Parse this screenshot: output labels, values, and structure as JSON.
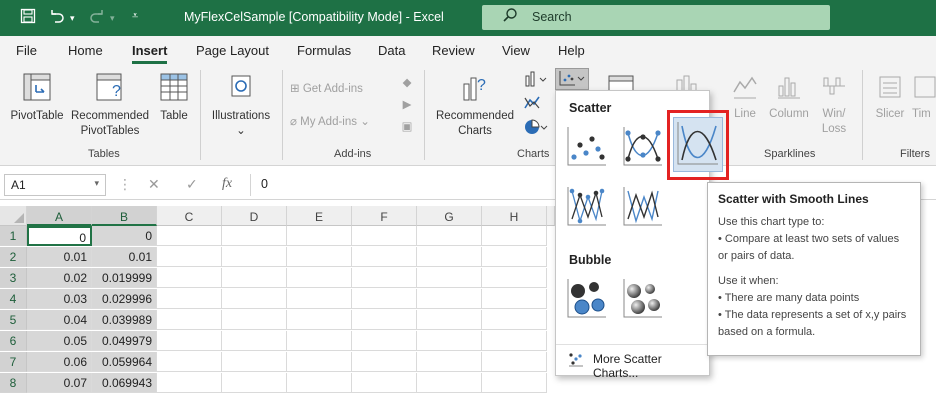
{
  "window": {
    "title": "MyFlexCelSample  [Compatibility Mode]  -  Excel",
    "search_placeholder": "Search"
  },
  "tabs": [
    "File",
    "Home",
    "Insert",
    "Page Layout",
    "Formulas",
    "Data",
    "Review",
    "View",
    "Help"
  ],
  "active_tab": "Insert",
  "ribbon": {
    "tables": {
      "group_label": "Tables",
      "pivottable": "PivotTable",
      "recommended_pivottables_1": "Recommended",
      "recommended_pivottables_2": "PivotTables",
      "table": "Table"
    },
    "illustrations": {
      "label": "Illustrations",
      "caret": "⌄"
    },
    "addins": {
      "group_label": "Add-ins",
      "get_addins": "Get Add-ins",
      "my_addins": "My Add-ins"
    },
    "charts": {
      "group_label": "Charts",
      "recommended_charts_1": "Recommended",
      "recommended_charts_2": "Charts"
    },
    "sparklines": {
      "group_label": "Sparklines",
      "line": "Line",
      "column": "Column",
      "winloss_1": "Win/",
      "winloss_2": "Loss"
    },
    "filters": {
      "group_label": "Filters",
      "slicer": "Slicer",
      "timeline": "Tim"
    }
  },
  "formula_bar": {
    "name_box": "A1",
    "fx_label": "fx",
    "value": "0"
  },
  "grid": {
    "columns": [
      "A",
      "B",
      "C",
      "D",
      "E",
      "F",
      "G",
      "H"
    ],
    "rows": [
      {
        "num": "1",
        "a": "0",
        "b": "0"
      },
      {
        "num": "2",
        "a": "0.01",
        "b": "0.01"
      },
      {
        "num": "3",
        "a": "0.02",
        "b": "0.019999"
      },
      {
        "num": "4",
        "a": "0.03",
        "b": "0.029996"
      },
      {
        "num": "5",
        "a": "0.04",
        "b": "0.039989"
      },
      {
        "num": "6",
        "a": "0.05",
        "b": "0.049979"
      },
      {
        "num": "7",
        "a": "0.06",
        "b": "0.059964"
      },
      {
        "num": "8",
        "a": "0.07",
        "b": "0.069943"
      }
    ]
  },
  "scatter_menu": {
    "scatter_header": "Scatter",
    "bubble_header": "Bubble",
    "more_link": "More Scatter Charts..."
  },
  "tooltip": {
    "title": "Scatter with Smooth Lines",
    "use_to": "Use this chart type to:",
    "bullet1": "• Compare at least two sets of values or pairs of data.",
    "use_when": "Use it when:",
    "bullet2": "• There are many data points",
    "bullet3": "• The data represents a set of x,y pairs based on a formula."
  },
  "colors": {
    "excel_green": "#1e7145",
    "highlight_red": "#e32222",
    "chart_blue": "#4a86c8"
  }
}
